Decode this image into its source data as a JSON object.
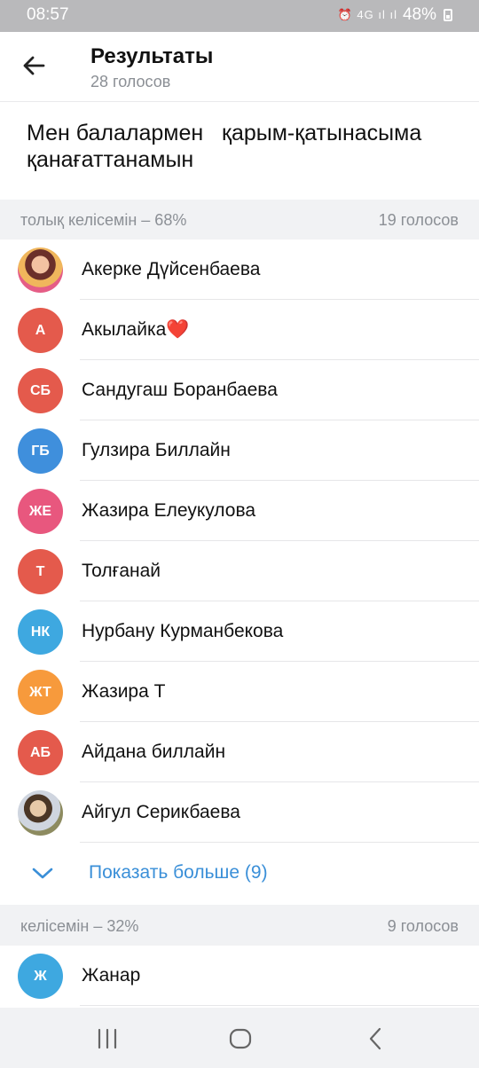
{
  "status_bar": {
    "time": "08:57",
    "icons": "⏰ 4G ıl ıl",
    "battery": "48%"
  },
  "header": {
    "title": "Результаты",
    "subtitle": "28 голосов"
  },
  "question": "Мен балалармен   қарым-қатынасыма қанағаттанамын",
  "sections": [
    {
      "label": "толық келісемін – 68%",
      "count": "19 голосов",
      "voters": [
        {
          "initials": "",
          "name": "Акерке Дүйсенбаева",
          "avatar_color": "photo"
        },
        {
          "initials": "А",
          "name": "Акылайка❤️",
          "avatar_color": "#e45a4c"
        },
        {
          "initials": "СБ",
          "name": "Сандугаш Боранбаева",
          "avatar_color": "#e45a4c"
        },
        {
          "initials": "ГБ",
          "name": "Гулзира Биллайн",
          "avatar_color": "#3f8fdc"
        },
        {
          "initials": "ЖЕ",
          "name": "Жазира Елеукулова",
          "avatar_color": "#e8577e"
        },
        {
          "initials": "Т",
          "name": "Толғанай",
          "avatar_color": "#e45a4c"
        },
        {
          "initials": "НК",
          "name": "Нурбану Курманбекова",
          "avatar_color": "#3ea8e0"
        },
        {
          "initials": "ЖТ",
          "name": "Жазира Т",
          "avatar_color": "#f79a3c"
        },
        {
          "initials": "АБ",
          "name": "Айдана биллайн",
          "avatar_color": "#e45a4c"
        },
        {
          "initials": "",
          "name": "Айгул Серикбаева",
          "avatar_color": "photo"
        }
      ],
      "show_more": "Показать больше (9)"
    },
    {
      "label": "келісемін – 32%",
      "count": "9 голосов",
      "voters": [
        {
          "initials": "Ж",
          "name": "Жанар",
          "avatar_color": "#3ea8e0"
        }
      ]
    }
  ],
  "colors": {
    "accent": "#3a8fd8",
    "secondary_text": "#8b8f95",
    "background": "#f1f2f4"
  },
  "nav_icons": [
    "recent-apps-icon",
    "home-icon",
    "back-nav-icon"
  ]
}
